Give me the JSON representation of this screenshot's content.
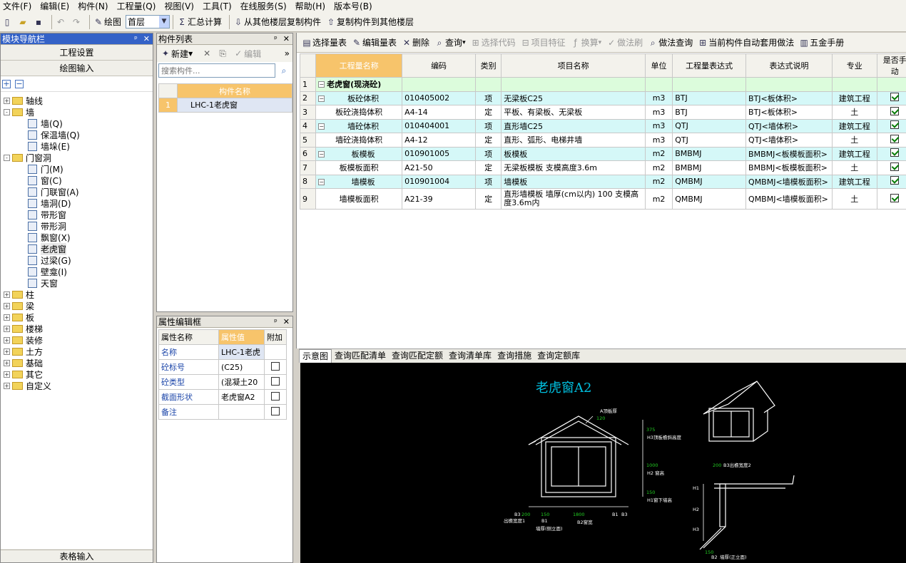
{
  "menu": [
    "文件(F)",
    "编辑(E)",
    "构件(N)",
    "工程量(Q)",
    "视图(V)",
    "工具(T)",
    "在线服务(S)",
    "帮助(H)",
    "版本号(B)"
  ],
  "toolbar": {
    "draw": "绘图",
    "floor": "首层",
    "sum": "汇总计算",
    "copy_from": "从其他楼层复制构件",
    "copy_to": "复制构件到其他楼层"
  },
  "nav": {
    "title": "模块导航栏",
    "project_settings": "工程设置",
    "draw_input": "绘图输入",
    "table_input": "表格输入",
    "tree": [
      {
        "label": "轴线",
        "level": 0,
        "state": "+",
        "kind": "folder"
      },
      {
        "label": "墙",
        "level": 0,
        "state": "-",
        "kind": "folder"
      },
      {
        "label": "墙(Q)",
        "level": 1,
        "kind": "item"
      },
      {
        "label": "保温墙(Q)",
        "level": 1,
        "kind": "item"
      },
      {
        "label": "墙垛(E)",
        "level": 1,
        "kind": "item"
      },
      {
        "label": "门窗洞",
        "level": 0,
        "state": "-",
        "kind": "folder"
      },
      {
        "label": "门(M)",
        "level": 1,
        "kind": "item"
      },
      {
        "label": "窗(C)",
        "level": 1,
        "kind": "item"
      },
      {
        "label": "门联窗(A)",
        "level": 1,
        "kind": "item"
      },
      {
        "label": "墙洞(D)",
        "level": 1,
        "kind": "item"
      },
      {
        "label": "带形窗",
        "level": 1,
        "kind": "item"
      },
      {
        "label": "带形洞",
        "level": 1,
        "kind": "item"
      },
      {
        "label": "飘窗(X)",
        "level": 1,
        "kind": "item"
      },
      {
        "label": "老虎窗",
        "level": 1,
        "kind": "item",
        "selected": true
      },
      {
        "label": "过梁(G)",
        "level": 1,
        "kind": "item"
      },
      {
        "label": "壁龛(I)",
        "level": 1,
        "kind": "item"
      },
      {
        "label": "天窗",
        "level": 1,
        "kind": "item"
      },
      {
        "label": "柱",
        "level": 0,
        "state": "+",
        "kind": "folder"
      },
      {
        "label": "梁",
        "level": 0,
        "state": "+",
        "kind": "folder"
      },
      {
        "label": "板",
        "level": 0,
        "state": "+",
        "kind": "folder"
      },
      {
        "label": "楼梯",
        "level": 0,
        "state": "+",
        "kind": "folder"
      },
      {
        "label": "装修",
        "level": 0,
        "state": "+",
        "kind": "folder"
      },
      {
        "label": "土方",
        "level": 0,
        "state": "+",
        "kind": "folder"
      },
      {
        "label": "基础",
        "level": 0,
        "state": "+",
        "kind": "folder"
      },
      {
        "label": "其它",
        "level": 0,
        "state": "+",
        "kind": "folder"
      },
      {
        "label": "自定义",
        "level": 0,
        "state": "+",
        "kind": "folder"
      }
    ]
  },
  "components": {
    "title": "构件列表",
    "new": "新建",
    "edit": "编辑",
    "search_placeholder": "搜索构件...",
    "col": "构件名称",
    "rows": [
      {
        "n": "1",
        "name": "LHC-1老虎窗"
      }
    ]
  },
  "props": {
    "title": "属性编辑框",
    "headers": [
      "属性名称",
      "属性值",
      "附加"
    ],
    "rows": [
      {
        "k": "名称",
        "v": "LHC-1老虎",
        "c": false
      },
      {
        "k": "砼标号",
        "v": "(C25)",
        "c": true
      },
      {
        "k": "砼类型",
        "v": "(混凝土20",
        "c": true
      },
      {
        "k": "截面形状",
        "v": "老虎窗A2",
        "c": true
      },
      {
        "k": "备注",
        "v": "",
        "c": true
      }
    ]
  },
  "qtoolbar": [
    "选择量表",
    "编辑量表",
    "删除",
    "查询",
    "选择代码",
    "项目特征",
    "换算",
    "做法刷",
    "做法查询",
    "当前构件自动套用做法",
    "五金手册"
  ],
  "qtable": {
    "headers": [
      "工程量名称",
      "编码",
      "类别",
      "项目名称",
      "单位",
      "工程量表达式",
      "表达式说明",
      "专业",
      "是否手动"
    ],
    "rows": [
      {
        "n": "1",
        "type": "t",
        "name": "老虎窗(现浇砼)",
        "code": "",
        "cat": "",
        "proj": "",
        "unit": "",
        "expr": "",
        "desc": "",
        "spec": "",
        "chk": null
      },
      {
        "n": "2",
        "type": "q",
        "name": "板砼体积",
        "code": "010405002",
        "cat": "项",
        "proj": "无梁板C25",
        "unit": "m3",
        "expr": "BTJ",
        "desc": "BTJ<板体积>",
        "spec": "建筑工程",
        "chk": true
      },
      {
        "n": "3",
        "type": "d",
        "name": "板砼浇捣体积",
        "code": "A4-14",
        "cat": "定",
        "proj": "平板、有梁板、无梁板",
        "unit": "m3",
        "expr": "BTJ",
        "desc": "BTJ<板体积>",
        "spec": "土",
        "chk": true
      },
      {
        "n": "4",
        "type": "q",
        "name": "墙砼体积",
        "code": "010404001",
        "cat": "项",
        "proj": "直形墙C25",
        "unit": "m3",
        "expr": "QTJ",
        "desc": "QTJ<墙体积>",
        "spec": "建筑工程",
        "chk": true
      },
      {
        "n": "5",
        "type": "d",
        "name": "墙砼浇捣体积",
        "code": "A4-12",
        "cat": "定",
        "proj": "直形、弧形、电梯井墙",
        "unit": "m3",
        "expr": "QTJ",
        "desc": "QTJ<墙体积>",
        "spec": "土",
        "chk": true
      },
      {
        "n": "6",
        "type": "q",
        "name": "板模板",
        "code": "010901005",
        "cat": "项",
        "proj": "板模板",
        "unit": "m2",
        "expr": "BMBMJ",
        "desc": "BMBMJ<板模板面积>",
        "spec": "建筑工程",
        "chk": true
      },
      {
        "n": "7",
        "type": "d",
        "name": "板模板面积",
        "code": "A21-50",
        "cat": "定",
        "proj": "无梁板模板 支模高度3.6m",
        "unit": "m2",
        "expr": "BMBMJ",
        "desc": "BMBMJ<板模板面积>",
        "spec": "土",
        "chk": true
      },
      {
        "n": "8",
        "type": "q",
        "name": "墙模板",
        "code": "010901004",
        "cat": "项",
        "proj": "墙模板",
        "unit": "m2",
        "expr": "QMBMJ",
        "desc": "QMBMJ<墙模板面积>",
        "spec": "建筑工程",
        "chk": true
      },
      {
        "n": "9",
        "type": "d",
        "name": "墙模板面积",
        "code": "A21-39",
        "cat": "定",
        "proj": "直形墙模板 墙厚(cm以内) 100 支模高度3.6m内",
        "unit": "m2",
        "expr": "QMBMJ",
        "desc": "QMBMJ<墙模板面积>",
        "spec": "土",
        "chk": true
      }
    ]
  },
  "tabs": [
    "示意图",
    "查询匹配清单",
    "查询匹配定额",
    "查询清单库",
    "查询措施",
    "查询定额库"
  ],
  "drawing": {
    "title": "老虎窗A2",
    "labels": {
      "a_top": "A顶板厚",
      "a_val": "120",
      "h3": "H3顶板檐斜高度",
      "h3_val": "375",
      "h2": "H2 窗高",
      "h2_val": "1000",
      "h1": "H1窗下墙高",
      "h1_val": "150",
      "b3l": "B3",
      "b1l": "B1",
      "b2": "B2窗宽",
      "b2_val": "1800",
      "b3_val_l": "200",
      "b1_val": "150",
      "bottom": "墙厚(侧立面)",
      "left_side": "出檐宽度1",
      "b1r": "B1",
      "b3r": "B3",
      "b3_side": "B3出檐宽度2",
      "b3_side_val": "200",
      "h1s": "H1",
      "h2s": "H2",
      "h3s": "H3",
      "side_bottom": "墙厚(正立面)",
      "b2_side": "B2",
      "side_val": "150"
    }
  }
}
